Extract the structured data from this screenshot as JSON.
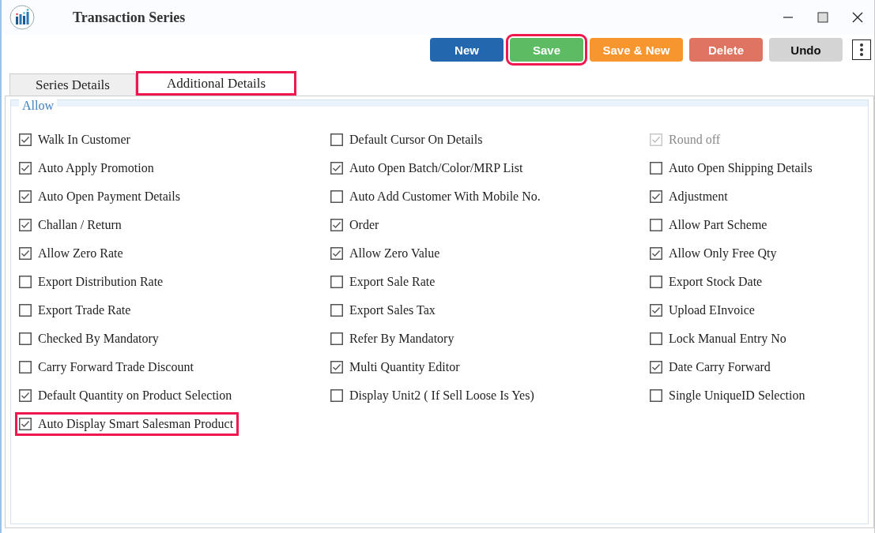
{
  "window": {
    "title": "Transaction Series"
  },
  "toolbar": {
    "buttons": [
      {
        "label": "New",
        "kind": "primary",
        "highlighted": false
      },
      {
        "label": "Save",
        "kind": "success",
        "highlighted": true
      },
      {
        "label": "Save & New",
        "kind": "warning",
        "highlighted": false
      },
      {
        "label": "Delete",
        "kind": "danger",
        "highlighted": false
      },
      {
        "label": "Undo",
        "kind": "neutral",
        "highlighted": false
      }
    ]
  },
  "tabs": [
    {
      "label": "Series Details",
      "selected": false,
      "highlighted": false
    },
    {
      "label": "Additional Details",
      "selected": true,
      "highlighted": true
    }
  ],
  "group": {
    "title": "Allow",
    "columns": [
      [
        {
          "label": "Walk In Customer",
          "checked": true,
          "disabled": false,
          "highlighted": false
        },
        {
          "label": "Auto Apply Promotion",
          "checked": true,
          "disabled": false,
          "highlighted": false
        },
        {
          "label": "Auto Open Payment Details",
          "checked": true,
          "disabled": false,
          "highlighted": false
        },
        {
          "label": "Challan / Return",
          "checked": true,
          "disabled": false,
          "highlighted": false
        },
        {
          "label": "Allow Zero Rate",
          "checked": true,
          "disabled": false,
          "highlighted": false
        },
        {
          "label": "Export Distribution Rate",
          "checked": false,
          "disabled": false,
          "highlighted": false
        },
        {
          "label": "Export Trade Rate",
          "checked": false,
          "disabled": false,
          "highlighted": false
        },
        {
          "label": "Checked By Mandatory",
          "checked": false,
          "disabled": false,
          "highlighted": false
        },
        {
          "label": "Carry Forward Trade Discount",
          "checked": false,
          "disabled": false,
          "highlighted": false
        },
        {
          "label": "Default Quantity on Product Selection",
          "checked": true,
          "disabled": false,
          "highlighted": false
        },
        {
          "label": "Auto Display Smart Salesman Product",
          "checked": true,
          "disabled": false,
          "highlighted": true
        }
      ],
      [
        {
          "label": "Default Cursor On Details",
          "checked": false,
          "disabled": false,
          "highlighted": false
        },
        {
          "label": "Auto Open Batch/Color/MRP List",
          "checked": true,
          "disabled": false,
          "highlighted": false
        },
        {
          "label": "Auto Add Customer With Mobile No.",
          "checked": false,
          "disabled": false,
          "highlighted": false
        },
        {
          "label": "Order",
          "checked": true,
          "disabled": false,
          "highlighted": false
        },
        {
          "label": "Allow Zero Value",
          "checked": true,
          "disabled": false,
          "highlighted": false
        },
        {
          "label": "Export Sale Rate",
          "checked": false,
          "disabled": false,
          "highlighted": false
        },
        {
          "label": "Export Sales Tax",
          "checked": false,
          "disabled": false,
          "highlighted": false
        },
        {
          "label": "Refer By Mandatory",
          "checked": false,
          "disabled": false,
          "highlighted": false
        },
        {
          "label": "Multi Quantity Editor",
          "checked": true,
          "disabled": false,
          "highlighted": false
        },
        {
          "label": "Display Unit2 ( If Sell Loose Is Yes)",
          "checked": false,
          "disabled": false,
          "highlighted": false
        }
      ],
      [
        {
          "label": "Round off",
          "checked": true,
          "disabled": true,
          "highlighted": false
        },
        {
          "label": "Auto Open Shipping Details",
          "checked": false,
          "disabled": false,
          "highlighted": false
        },
        {
          "label": "Adjustment",
          "checked": true,
          "disabled": false,
          "highlighted": false
        },
        {
          "label": "Allow Part Scheme",
          "checked": false,
          "disabled": false,
          "highlighted": false
        },
        {
          "label": "Allow Only Free Qty",
          "checked": true,
          "disabled": false,
          "highlighted": false
        },
        {
          "label": "Export Stock Date",
          "checked": false,
          "disabled": false,
          "highlighted": false
        },
        {
          "label": "Upload EInvoice",
          "checked": true,
          "disabled": false,
          "highlighted": false
        },
        {
          "label": "Lock Manual Entry No",
          "checked": false,
          "disabled": false,
          "highlighted": false
        },
        {
          "label": "Date Carry Forward",
          "checked": true,
          "disabled": false,
          "highlighted": false
        },
        {
          "label": "Single UniqueID Selection",
          "checked": false,
          "disabled": false,
          "highlighted": false
        }
      ]
    ]
  }
}
